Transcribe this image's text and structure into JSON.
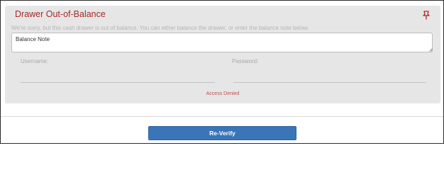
{
  "dialog": {
    "title": "Drawer Out-of-Balance",
    "pin_icon": "pushpin-icon",
    "message": "We're sorry, but this cash drawer is out of balance. You can either balance the drawer, or enter the balance note below.",
    "balance_note": {
      "placeholder": "Balance Note",
      "value": ""
    },
    "username": {
      "label": "Username:",
      "value": ""
    },
    "password": {
      "label": "Password:",
      "value": ""
    },
    "status_text": "Access Denied",
    "reverify_label": "Re-Verify"
  },
  "colors": {
    "title": "#a52a2a",
    "status": "#c0504d",
    "button": "#3a75b8",
    "panel": "#e6e6e6"
  }
}
